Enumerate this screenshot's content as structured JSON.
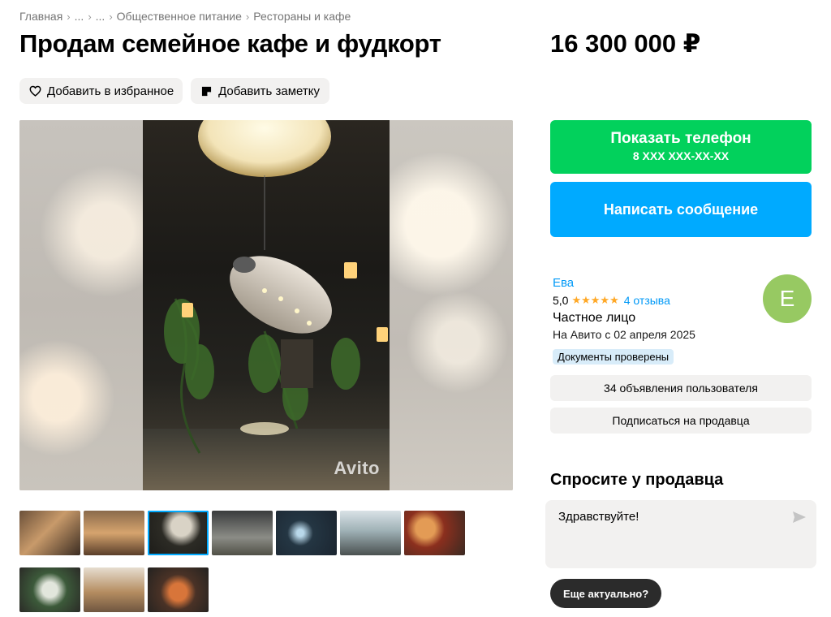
{
  "breadcrumb": [
    "Главная",
    "...",
    "...",
    "Общественное питание",
    "Рестораны и кафе"
  ],
  "title": "Продам семейное кафе и фудкорт",
  "price": "16 300 000 ₽",
  "actions": {
    "favorite": "Добавить в избранное",
    "note": "Добавить заметку"
  },
  "gallery": {
    "watermark": "Avito",
    "thumbnail_count": 10,
    "active_thumbnail": 3
  },
  "contact": {
    "show_phone": "Показать телефон",
    "phone_mask": "8 XXX XXX-XX-XX",
    "write_message": "Написать сообщение"
  },
  "seller": {
    "name": "Ева",
    "rating": "5,0",
    "stars": "★★★★★",
    "reviews": "4 отзыва",
    "type": "Частное лицо",
    "since": "На Авито с 02 апреля 2025",
    "docs_badge": "Документы проверены",
    "avatar_letter": "Е",
    "avatar_color": "#97c962",
    "listings_button": "34 объявления пользователя",
    "subscribe_button": "Подписаться на продавца"
  },
  "ask": {
    "title": "Спросите у продавца",
    "message": "Здравствуйте!",
    "quick_reply": "Еще актуально?"
  },
  "colors": {
    "green": "#02d15c",
    "blue": "#00aaff",
    "link": "#0099f7",
    "star": "#ffa826"
  }
}
